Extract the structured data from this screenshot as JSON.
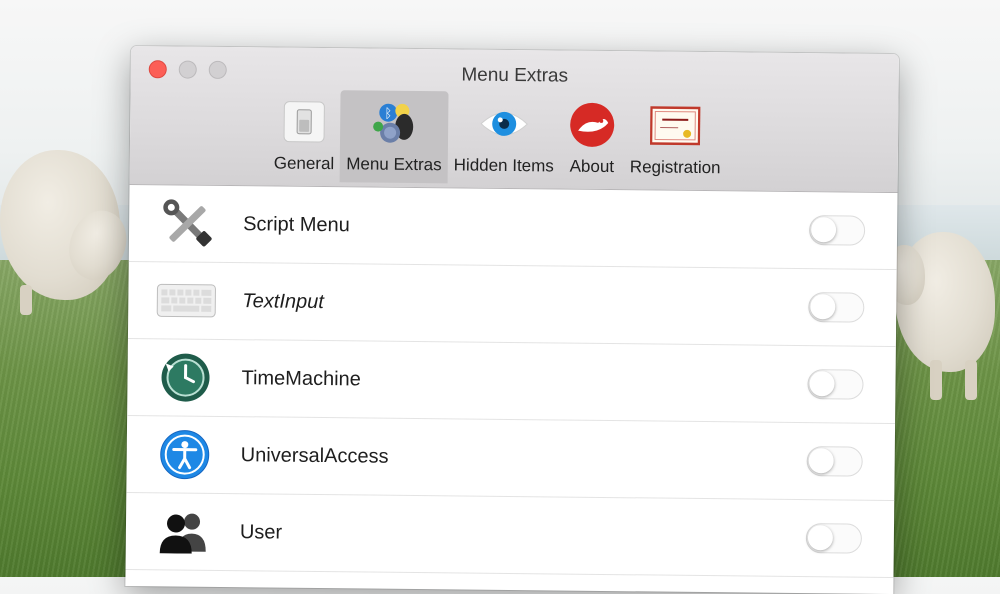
{
  "window": {
    "title": "Menu Extras"
  },
  "toolbar": {
    "tabs": [
      {
        "label": "General",
        "icon": "switch-icon",
        "selected": false
      },
      {
        "label": "Menu Extras",
        "icon": "menu-extras-icon",
        "selected": true
      },
      {
        "label": "Hidden Items",
        "icon": "eye-icon",
        "selected": false
      },
      {
        "label": "About",
        "icon": "bartender-logo-icon",
        "selected": false
      },
      {
        "label": "Registration",
        "icon": "license-certificate-icon",
        "selected": false
      }
    ]
  },
  "items": [
    {
      "label": "Script Menu",
      "icon": "tools-icon",
      "enabled": false
    },
    {
      "label": "TextInput",
      "icon": "keyboard-icon",
      "enabled": false
    },
    {
      "label": "TimeMachine",
      "icon": "time-machine-icon",
      "enabled": false
    },
    {
      "label": "UniversalAccess",
      "icon": "accessibility-icon",
      "enabled": false
    },
    {
      "label": "User",
      "icon": "users-icon",
      "enabled": false
    }
  ],
  "colors": {
    "close": "#fc5e56",
    "selected_tab": "#c4c2c4",
    "accessibility_blue": "#1e88e5",
    "about_red": "#d62a25"
  }
}
